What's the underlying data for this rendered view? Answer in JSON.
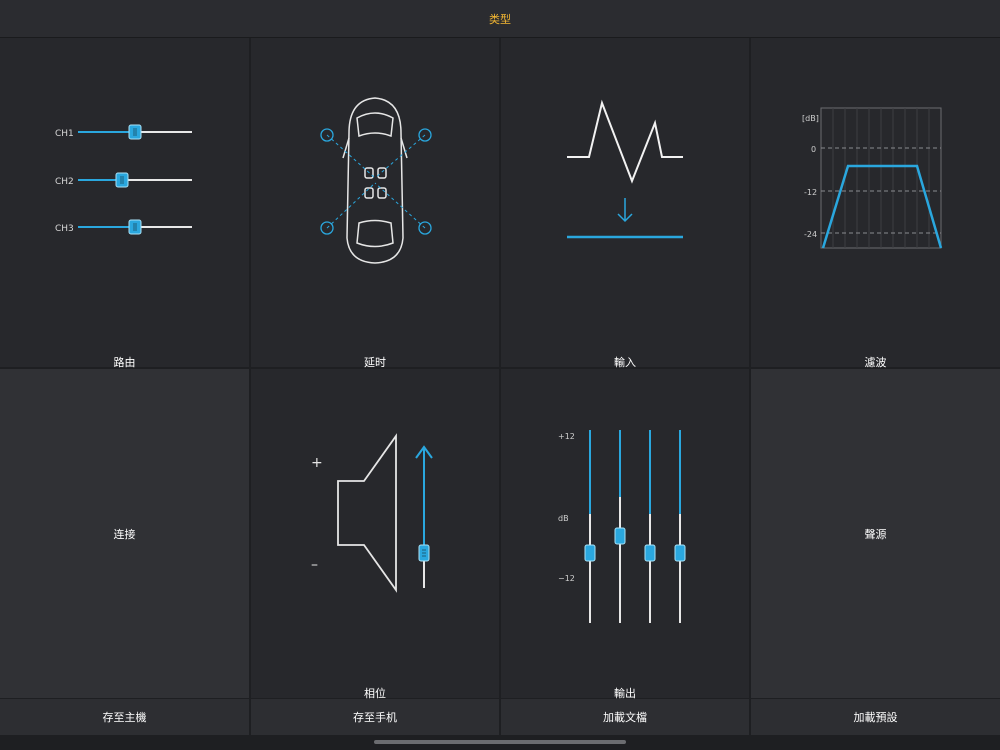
{
  "header": {
    "title": "类型"
  },
  "tiles": {
    "routing": {
      "label": "路由",
      "channels": [
        "CH1",
        "CH2",
        "CH3"
      ],
      "levels": [
        0.5,
        0.39,
        0.5
      ]
    },
    "delay": {
      "label": "延时"
    },
    "input": {
      "label": "輸入"
    },
    "filter": {
      "label": "濾波",
      "unit": "[dB]",
      "ticks": [
        "0",
        "-12",
        "-24"
      ]
    },
    "connect": {
      "label": "连接"
    },
    "phase": {
      "label": "相位",
      "plus": "+",
      "minus": "–"
    },
    "output": {
      "label": "輸出",
      "top": "+12",
      "mid": "dB",
      "bottom": "−12",
      "levels": [
        0.5,
        0.6,
        0.5,
        0.5
      ]
    },
    "source": {
      "label": "聲源"
    }
  },
  "bottom": {
    "save_host": "存至主機",
    "save_phone": "存至手机",
    "load_file": "加載文檔",
    "load_preset": "加載預設"
  },
  "colors": {
    "accent": "#2aa7de",
    "title": "#f2b632"
  }
}
